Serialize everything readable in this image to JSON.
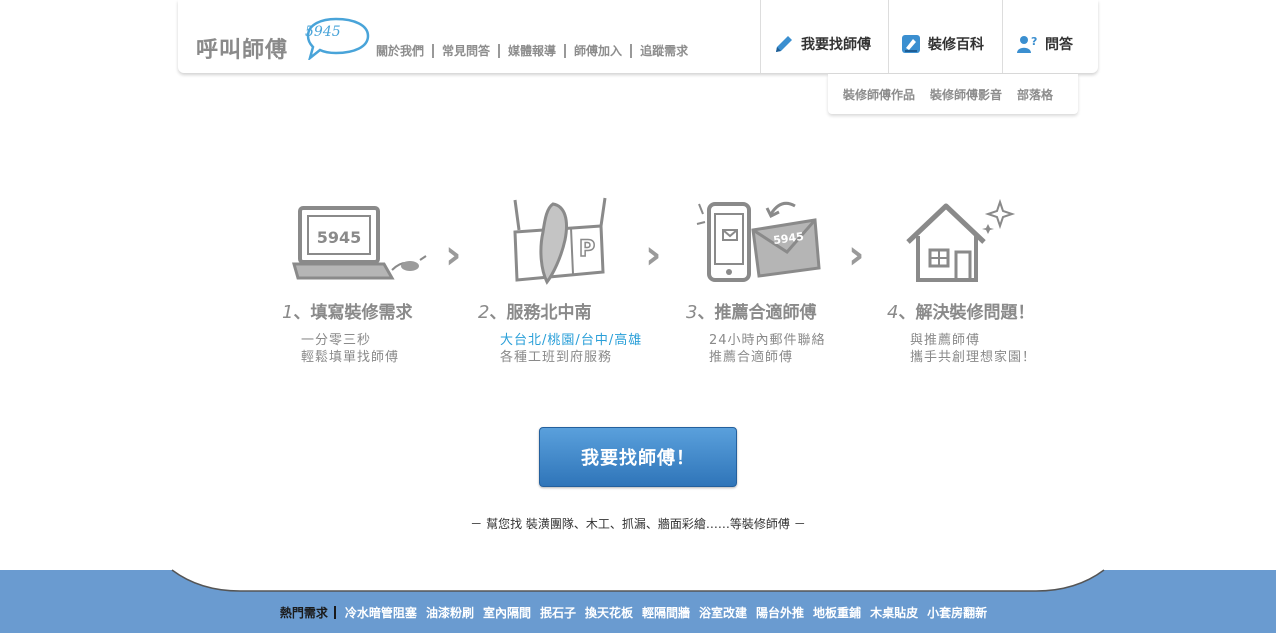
{
  "logo": {
    "text": "呼叫師傅",
    "number": "5945"
  },
  "subnav": [
    "關於我們",
    "常見問答",
    "媒體報導",
    "師傅加入",
    "追蹤需求"
  ],
  "mainnav": [
    {
      "label": "我要找師傅",
      "icon": "pencil-icon"
    },
    {
      "label": "裝修百科",
      "icon": "book-icon"
    },
    {
      "label": "問答",
      "icon": "user-question-icon"
    }
  ],
  "dropnav": [
    "裝修師傅作品",
    "裝修師傅影音",
    "部落格"
  ],
  "steps": [
    {
      "num": "1",
      "title": "填寫裝修需求",
      "line1": "一分零三秒",
      "line2": "輕鬆填單找師傅",
      "image_text": "5945"
    },
    {
      "num": "2",
      "title": "服務北中南",
      "line1_parts": [
        "大台北",
        "桃園",
        "台中",
        "高雄"
      ],
      "line2": "各種工班到府服務"
    },
    {
      "num": "3",
      "title": "推薦合適師傅",
      "line1": "24小時內郵件聯絡",
      "line2": "推薦合適師傅",
      "image_text": "5945"
    },
    {
      "num": "4",
      "title": "解決裝修問題！",
      "line1": "與推薦師傅",
      "line2": "攜手共創理想家園！"
    }
  ],
  "cta": {
    "label": "我要找師傅！"
  },
  "tagline": "－ 幫您找 裝潢團隊、木工、抓漏、牆面彩繪……等裝修師傅 －",
  "footer": {
    "label": "熱門需求",
    "items": [
      "冷水暗管阻塞",
      "油漆粉刷",
      "室內隔間",
      "抿石子",
      "換天花板",
      "輕隔間牆",
      "浴室改建",
      "陽台外推",
      "地板重鋪",
      "木桌貼皮",
      "小套房翻新"
    ]
  },
  "colors": {
    "accent": "#2a9fd8",
    "footer_bg": "#6a9bd0",
    "cta_top": "#5aa0dc",
    "cta_bottom": "#2f75b9"
  }
}
